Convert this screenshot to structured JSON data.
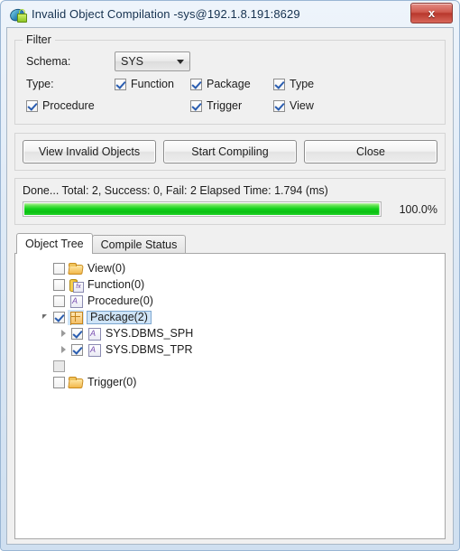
{
  "window": {
    "title": "Invalid Object Compilation -sys@192.1.8.191:8629",
    "icon": "database-lock-icon",
    "close_label": "x"
  },
  "filter": {
    "legend": "Filter",
    "schema_label": "Schema:",
    "schema_value": "SYS",
    "type_label": "Type:",
    "checkboxes": [
      {
        "label": "Function",
        "checked": true
      },
      {
        "label": "Package",
        "checked": true
      },
      {
        "label": "Type",
        "checked": true
      },
      {
        "label": "Procedure",
        "checked": true
      },
      {
        "label": "Trigger",
        "checked": true
      },
      {
        "label": "View",
        "checked": true
      }
    ]
  },
  "actions": {
    "view_invalid_objects": "View Invalid Objects",
    "start_compiling": "Start Compiling",
    "close": "Close"
  },
  "progress": {
    "status_text": "Done... Total: 2, Success: 0, Fail: 2 Elapsed Time: 1.794 (ms)",
    "percent_label": "100.0%",
    "percent_value": 100,
    "bar_color": "#12d21a"
  },
  "tabs": [
    {
      "label": "Object Tree",
      "active": true
    },
    {
      "label": "Compile Status",
      "active": false
    }
  ],
  "tree": {
    "rows": [
      {
        "label": "View(0)",
        "icon": "folder-icon",
        "checked": false,
        "expander": "none",
        "indent": 0,
        "selected": false
      },
      {
        "label": "Function(0)",
        "icon": "function-icon",
        "checked": false,
        "expander": "none",
        "indent": 0,
        "selected": false
      },
      {
        "label": "Procedure(0)",
        "icon": "procedure-icon",
        "checked": false,
        "expander": "none",
        "indent": 0,
        "selected": false
      },
      {
        "label": "Package(2)",
        "icon": "package-icon",
        "checked": true,
        "expander": "expanded",
        "indent": 0,
        "selected": true
      },
      {
        "label": "SYS.DBMS_SPH",
        "icon": "procedure-icon",
        "checked": true,
        "expander": "collapsed",
        "indent": 1,
        "selected": false
      },
      {
        "label": "SYS.DBMS_TPR",
        "icon": "procedure-icon",
        "checked": true,
        "expander": "collapsed",
        "indent": 1,
        "selected": false
      },
      {
        "label": "",
        "icon": "none",
        "checked": false,
        "expander": "none",
        "indent": 0,
        "selected": false
      },
      {
        "label": "Trigger(0)",
        "icon": "folder-icon",
        "checked": false,
        "expander": "none",
        "indent": 0,
        "selected": false
      }
    ]
  }
}
